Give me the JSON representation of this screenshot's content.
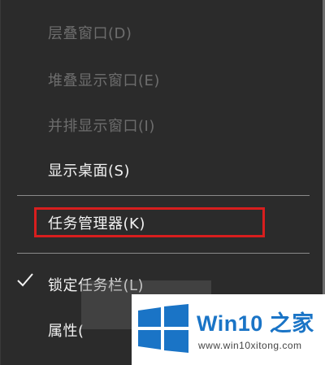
{
  "menu": {
    "items": [
      {
        "label": "层叠窗口(D)",
        "enabled": false
      },
      {
        "label": "堆叠显示窗口(E)",
        "enabled": false
      },
      {
        "label": "并排显示窗口(I)",
        "enabled": false
      },
      {
        "label": "显示桌面(S)",
        "enabled": true
      },
      {
        "label": "任务管理器(K)",
        "enabled": true,
        "highlighted": true
      },
      {
        "label": "锁定任务栏(L)",
        "enabled": true,
        "checked": true
      },
      {
        "label": "属性(",
        "enabled": true
      }
    ]
  },
  "watermark": {
    "brand": "Win10 之家",
    "url": "www.win10xitong.com",
    "logo_color": "#1a74c6"
  },
  "colors": {
    "highlight_border": "#d81e1e",
    "menu_background": "#2b2b2b"
  }
}
